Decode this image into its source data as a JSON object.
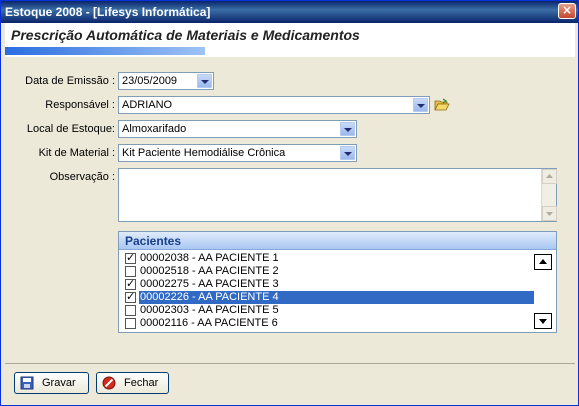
{
  "window": {
    "title": "Estoque 2008 - [Lifesys Informática]",
    "close": "×"
  },
  "header": {
    "title": "Prescrição Automática de Materiais e Medicamentos"
  },
  "form": {
    "date_label": "Data de Emissão :",
    "date_value": "23/05/2009",
    "responsible_label": "Responsável :",
    "responsible_value": "ADRIANO",
    "stock_label": "Local de Estoque:",
    "stock_value": "Almoxarifado",
    "kit_label": "Kit de Material :",
    "kit_value": "Kit Paciente Hemodiálise Crônica",
    "obs_label": "Observação :",
    "obs_value": ""
  },
  "patients": {
    "header": "Pacientes",
    "items": [
      {
        "label": "00002038 - AA PACIENTE 1",
        "checked": true
      },
      {
        "label": "00002518 - AA PACIENTE 2",
        "checked": false
      },
      {
        "label": "00002275 - AA PACIENTE 3",
        "checked": true
      },
      {
        "label": "00002226 - AA PACIENTE 4",
        "checked": true,
        "selected": true
      },
      {
        "label": "00002303 - AA PACIENTE 5",
        "checked": false
      },
      {
        "label": "00002116 - AA PACIENTE 6",
        "checked": false
      }
    ]
  },
  "footer": {
    "save_label": "Gravar",
    "close_label": "Fechar"
  },
  "colors": {
    "selection": "#316ac5",
    "titlebar": "#0a246a"
  }
}
